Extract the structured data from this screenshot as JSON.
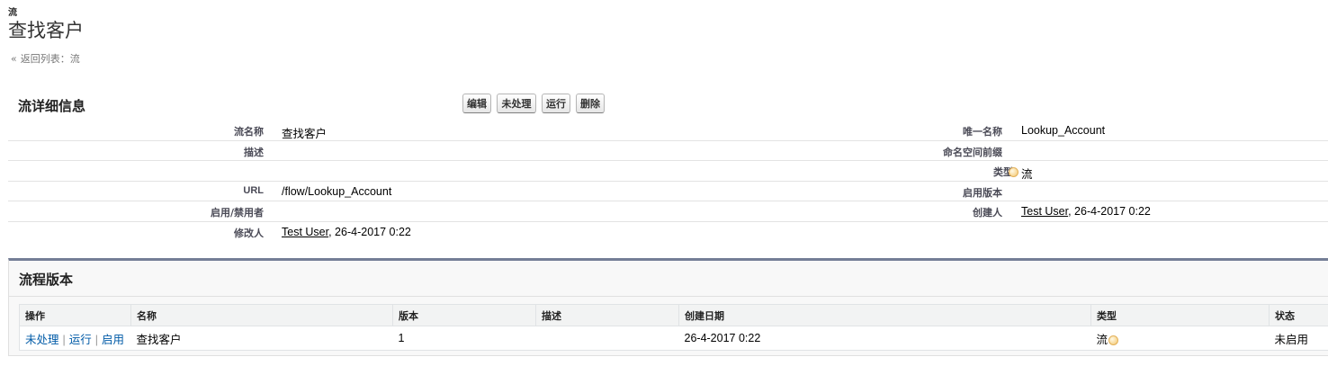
{
  "header": {
    "type_label": "流",
    "title": "查找客户",
    "back_arrow": "«",
    "back_link": "返回列表：流"
  },
  "details": {
    "section_title": "流详细信息",
    "buttons": {
      "edit": "编辑",
      "deactivate": "未处理",
      "run": "运行",
      "delete": "删除"
    },
    "rows": {
      "flow_name_label": "流名称",
      "flow_name_value": "查找客户",
      "unique_name_label": "唯一名称",
      "unique_name_value": "Lookup_Account",
      "description_label": "描述",
      "namespace_label": "命名空间前缀",
      "type_label": "类型",
      "type_value": "流",
      "url_label": "URL",
      "url_value": "/flow/Lookup_Account",
      "active_version_label": "启用版本",
      "toggled_by_label": "启用/禁用者",
      "created_by_label": "创建人",
      "created_by_user": "Test User",
      "created_by_date": ", 26-4-2017 0:22",
      "modified_by_label": "修改人",
      "modified_by_user": "Test User",
      "modified_by_date": ", 26-4-2017 0:22"
    }
  },
  "versions": {
    "section_title": "流程版本",
    "columns": {
      "action": "操作",
      "name": "名称",
      "version": "版本",
      "description": "描述",
      "created_date": "创建日期",
      "type": "类型",
      "status": "状态"
    },
    "row": {
      "action_deactivate": "未处理",
      "action_run": "运行",
      "action_activate": "启用",
      "separator": "|",
      "name": "查找客户",
      "version": "1",
      "description": "",
      "created_date": "26-4-2017 0:22",
      "type": "流",
      "status": "未启用"
    }
  },
  "colors": {
    "link_blue": "#015ba7",
    "panel_border": "#747e96",
    "flow_icon": "#f3c56a"
  },
  "icons": {
    "flow_type": "flow-type-icon"
  }
}
